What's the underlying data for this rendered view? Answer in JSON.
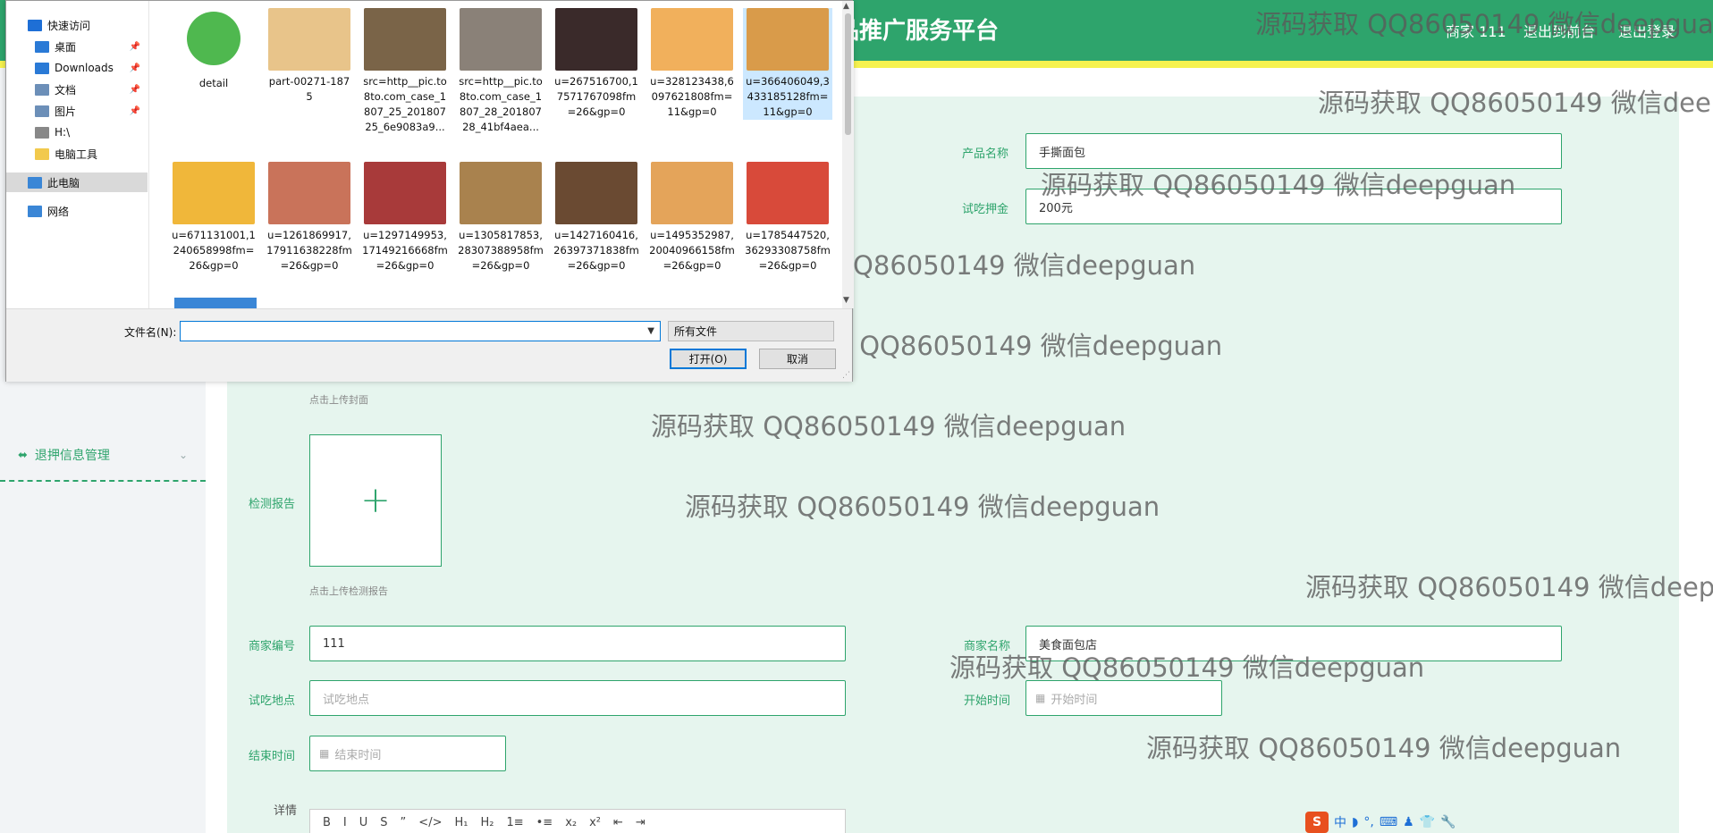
{
  "header": {
    "title": "品推广服务平台",
    "user": "商家 111",
    "link_back": "退出到前台",
    "link_logout": "退出登录"
  },
  "sidebar": {
    "item_label": "退押信息管理"
  },
  "form": {
    "product_name_label": "产品名称",
    "product_name_value": "手撕面包",
    "deposit_label": "试吃押金",
    "deposit_value": "200元",
    "cover_hint": "点击上传封面",
    "report_label": "检测报告",
    "report_hint": "点击上传检测报告",
    "merchant_no_label": "商家编号",
    "merchant_no_value": "111",
    "merchant_name_label": "商家名称",
    "merchant_name_value": "美食面包店",
    "location_label": "试吃地点",
    "location_placeholder": "试吃地点",
    "start_label": "开始时间",
    "start_placeholder": "开始时间",
    "end_label": "结束时间",
    "end_placeholder": "结束时间",
    "details_label": "详情",
    "editor_tools": [
      "B",
      "I",
      "U",
      "S",
      "”",
      "</>",
      "H₁",
      "H₂",
      "1≡",
      "•≡",
      "x₂",
      "x²",
      "⇤",
      "⇥"
    ]
  },
  "watermark": "源码获取 QQ86050149 微信deepguan",
  "dialog": {
    "nav": [
      {
        "label": "快速访问",
        "icon": "star-icon",
        "color": "#1e6fd6"
      },
      {
        "label": "桌面",
        "icon": "desktop-icon",
        "color": "#2a7ad6"
      },
      {
        "label": "Downloads",
        "icon": "download-icon",
        "color": "#2a7ad6"
      },
      {
        "label": "文档",
        "icon": "document-icon",
        "color": "#6c8fb8"
      },
      {
        "label": "图片",
        "icon": "pictures-icon",
        "color": "#6c8fb8"
      },
      {
        "label": "H:\\",
        "icon": "drive-icon",
        "color": "#888888"
      },
      {
        "label": "电脑工具",
        "icon": "folder-icon",
        "color": "#f2c94c"
      },
      {
        "label": "此电脑",
        "icon": "computer-icon",
        "color": "#3a86d6"
      },
      {
        "label": "网络",
        "icon": "network-icon",
        "color": "#3a86d6"
      }
    ],
    "files": [
      {
        "name": "detail",
        "color": "#4fb84f"
      },
      {
        "name": "part-00271-1875",
        "color": "#e8c48a"
      },
      {
        "name": "src=http__pic.to8to.com_case_1807_25_20180725_6e9083a9...",
        "color": "#7a6448"
      },
      {
        "name": "src=http__pic.to8to.com_case_1807_28_20180728_41bf4aea...",
        "color": "#8a8178"
      },
      {
        "name": "u=267516700,17571767098fm=26&gp=0",
        "color": "#3a2a2a"
      },
      {
        "name": "u=328123438,6097621808fm=11&gp=0",
        "color": "#f1b05c"
      },
      {
        "name": "u=366406049,3433185128fm=11&gp=0",
        "color": "#d99b4a"
      },
      {
        "name": "u=671131001,1240658998fm=26&gp=0",
        "color": "#f0b73a"
      },
      {
        "name": "u=1261869917,17911638228fm=26&gp=0",
        "color": "#c9735a"
      },
      {
        "name": "u=1297149953,17149216668fm=26&gp=0",
        "color": "#a83a3a"
      },
      {
        "name": "u=1305817853,28307388958fm=26&gp=0",
        "color": "#a9824e"
      },
      {
        "name": "u=1427160416,26397371838fm=26&gp=0",
        "color": "#6a4a32"
      },
      {
        "name": "u=1495352987,20040966158fm=26&gp=0",
        "color": "#e4a45a"
      },
      {
        "name": "u=1785447520,36293308758fm=26&gp=0",
        "color": "#d84a3a"
      }
    ],
    "filename_label": "文件名(N):",
    "filter_value": "所有文件",
    "open_label": "打开(O)",
    "cancel_label": "取消"
  },
  "ime": {
    "logo": "S",
    "chars": [
      "中",
      "◗",
      "°,",
      "⌨",
      "♟",
      "👕",
      "🔧"
    ]
  }
}
